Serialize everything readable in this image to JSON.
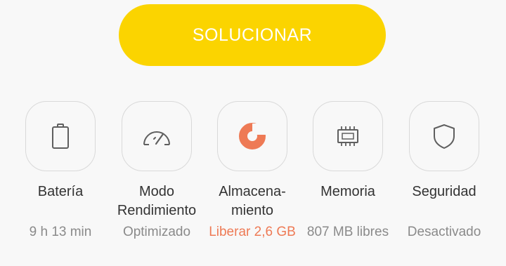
{
  "fix_button": {
    "label": "SOLUCIONAR"
  },
  "colors": {
    "accent_yellow": "#fbd400",
    "storage_orange": "#ee7a55",
    "icon_gray": "#5f5f5f",
    "status_gray": "#8a8a8a"
  },
  "tiles": [
    {
      "icon": "battery-icon",
      "label": "Batería",
      "status": "9 h 13 min"
    },
    {
      "icon": "speedometer-icon",
      "label": "Modo\nRendimiento",
      "status": "Optimizado"
    },
    {
      "icon": "storage-pie-icon",
      "label": "Almacena-\nmiento",
      "status": "Liberar 2,6 GB"
    },
    {
      "icon": "memory-chip-icon",
      "label": "Memoria",
      "status": "807 MB libres"
    },
    {
      "icon": "shield-icon",
      "label": "Seguridad",
      "status": "Desactivado"
    }
  ]
}
